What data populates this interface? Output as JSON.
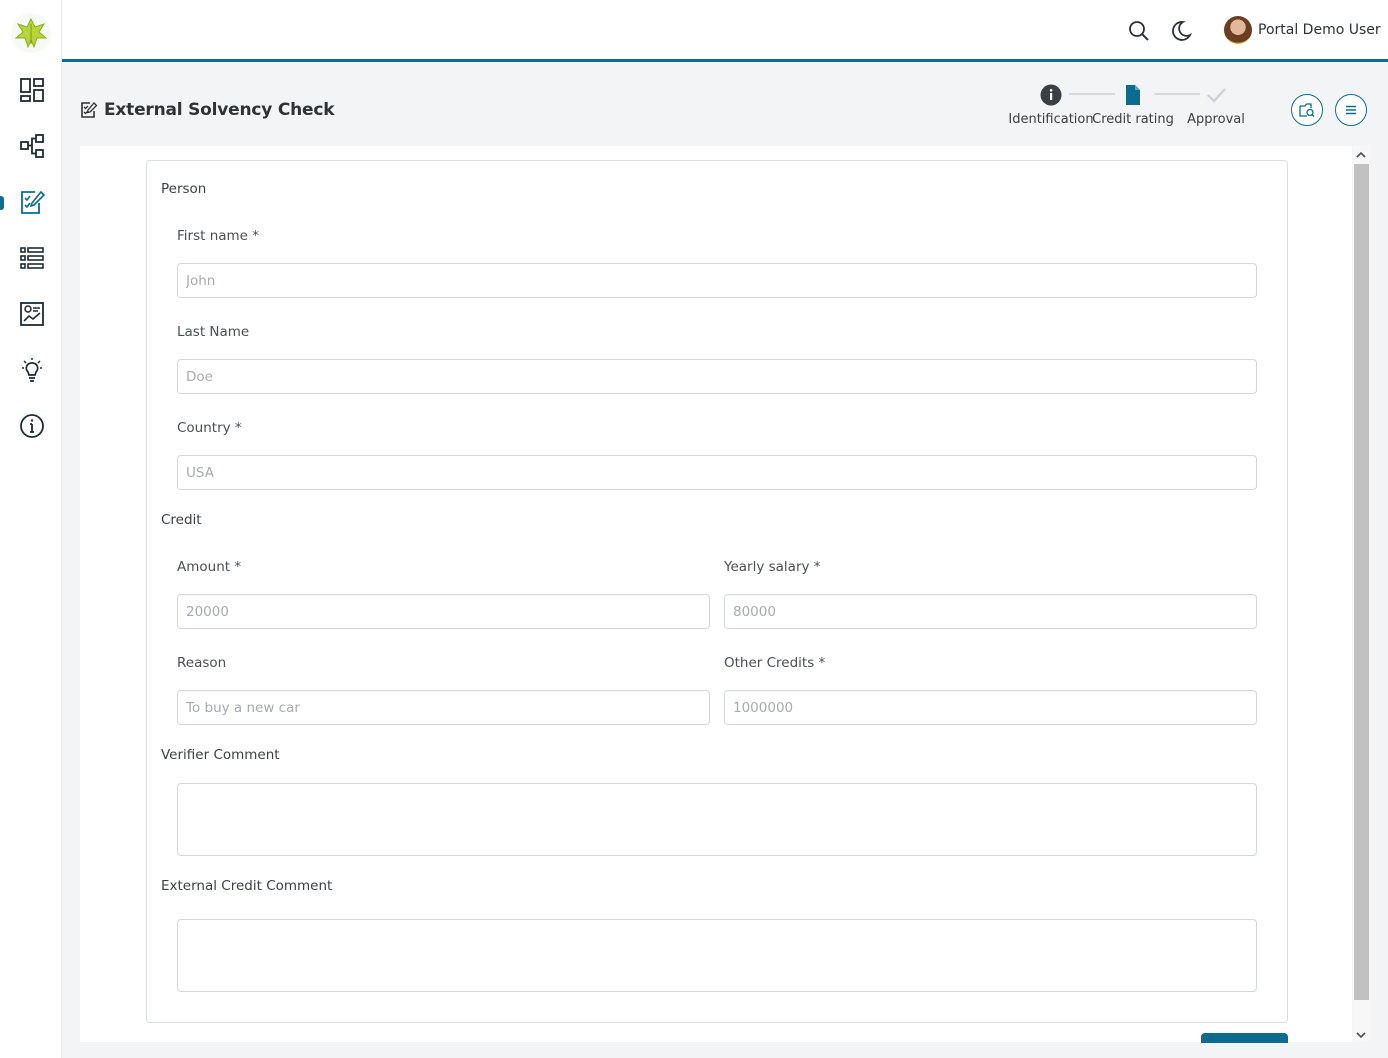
{
  "sidebar": {
    "icons": [
      "dashboard-icon",
      "process-icon",
      "task-icon",
      "case-list-icon",
      "statistics-icon",
      "idea-icon",
      "info-icon"
    ],
    "active_index": 2
  },
  "topbar": {
    "user_name": "Portal Demo User",
    "icons": [
      "search-icon",
      "dark-mode-icon"
    ]
  },
  "page": {
    "title": "External Solvency Check"
  },
  "stepper": {
    "steps": [
      {
        "label": "Identification",
        "state": "done",
        "icon": "info-icon"
      },
      {
        "label": "Credit rating",
        "state": "active",
        "icon": "document-icon"
      },
      {
        "label": "Approval",
        "state": "pending",
        "icon": "check-icon"
      }
    ]
  },
  "colors": {
    "accent": "#0d6b8d",
    "brand_leaf": "#b7d43a"
  },
  "form": {
    "person": {
      "title": "Person",
      "first_name": {
        "label": "First name *",
        "placeholder": "John"
      },
      "last_name": {
        "label": "Last Name",
        "placeholder": "Doe"
      },
      "country": {
        "label": "Country *",
        "placeholder": "USA"
      }
    },
    "credit": {
      "title": "Credit",
      "amount": {
        "label": "Amount *",
        "placeholder": "20000"
      },
      "yearly_salary": {
        "label": "Yearly salary *",
        "placeholder": "80000"
      },
      "reason": {
        "label": "Reason",
        "placeholder": "To buy a new car"
      },
      "other_credits": {
        "label": "Other Credits *",
        "placeholder": "1000000"
      }
    },
    "verifier_comment": {
      "title": "Verifier Comment"
    },
    "external_credit_comment": {
      "title": "External Credit Comment"
    }
  }
}
